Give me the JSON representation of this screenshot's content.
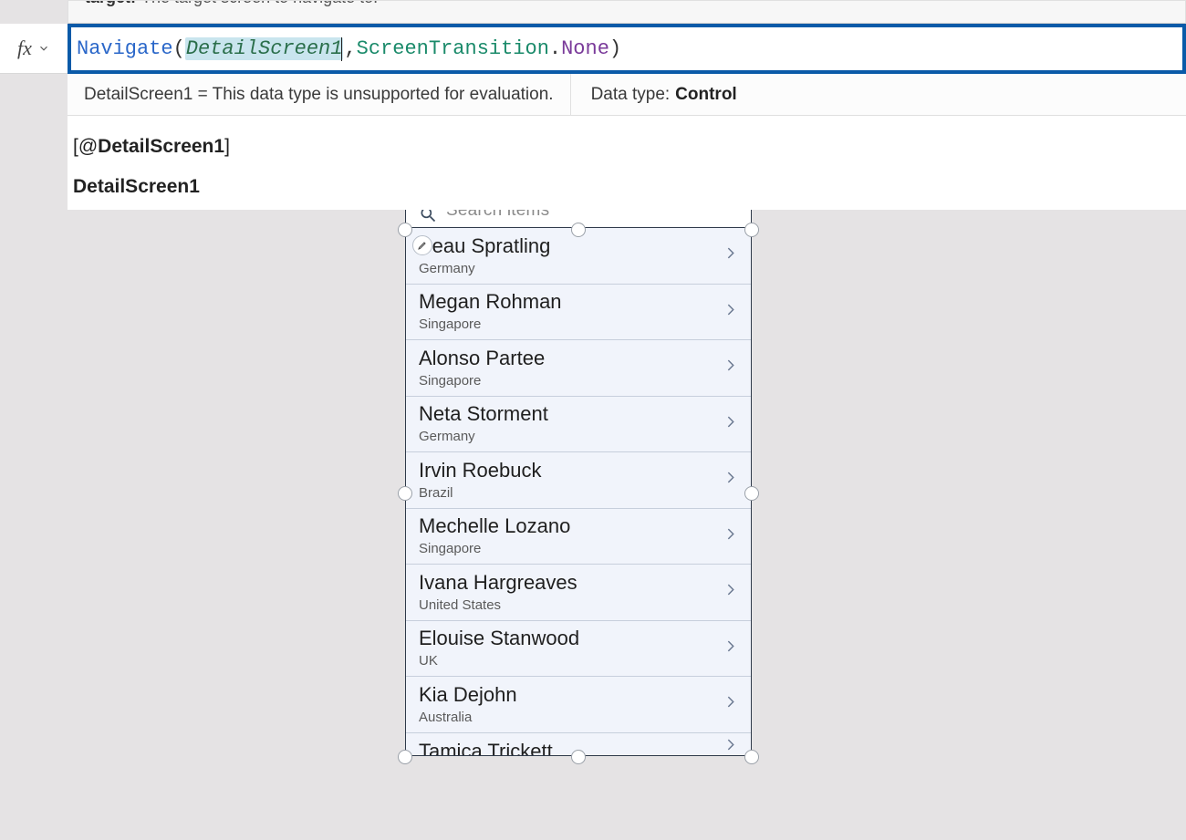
{
  "tooltip": {
    "label": "target:",
    "desc": "The target screen to navigate to."
  },
  "fx": {
    "label": "fx"
  },
  "formula": {
    "func": "Navigate",
    "open": "(",
    "arg1_selected": "DetailScreen1",
    "comma": ", ",
    "enum": "ScreenTransition",
    "dot": ".",
    "member": "None",
    "close": ")"
  },
  "info": {
    "eval": "DetailScreen1  =  This data type is unsupported for evaluation.",
    "dtlabel": "Data type:",
    "dtvalue": "Control"
  },
  "intelli": {
    "row1_pre": "[@",
    "row1_name": "DetailScreen1",
    "row1_post": "]",
    "row2": "DetailScreen1"
  },
  "search": {
    "placeholder": "Search items"
  },
  "items": [
    {
      "name": "Beau Spratling",
      "sub": "Germany"
    },
    {
      "name": "Megan Rohman",
      "sub": "Singapore"
    },
    {
      "name": "Alonso Partee",
      "sub": "Singapore"
    },
    {
      "name": "Neta Storment",
      "sub": "Germany"
    },
    {
      "name": "Irvin Roebuck",
      "sub": "Brazil"
    },
    {
      "name": "Mechelle Lozano",
      "sub": "Singapore"
    },
    {
      "name": "Ivana Hargreaves",
      "sub": "United States"
    },
    {
      "name": "Elouise Stanwood",
      "sub": "UK"
    },
    {
      "name": "Kia Dejohn",
      "sub": "Australia"
    },
    {
      "name": "Tamica Trickett",
      "sub": ""
    }
  ]
}
